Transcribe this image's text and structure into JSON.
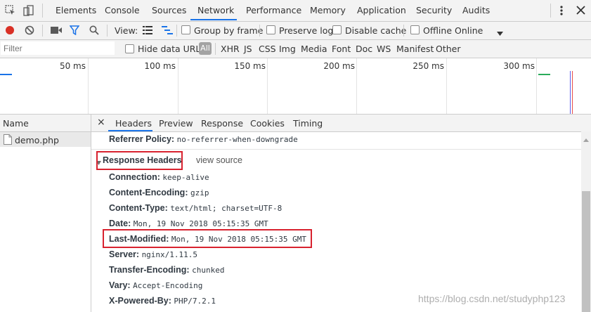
{
  "tabs": [
    "Elements",
    "Console",
    "Sources",
    "Network",
    "Performance",
    "Memory",
    "Application",
    "Security",
    "Audits"
  ],
  "toolbar": {
    "view_label": "View:",
    "group_by_frame": "Group by frame",
    "preserve_log": "Preserve log",
    "disable_cache": "Disable cache",
    "offline": "Offline",
    "throttle_value": "Online"
  },
  "filter": {
    "placeholder": "Filter",
    "hide_data_urls": "Hide data URLs",
    "all": "All",
    "types": [
      "XHR",
      "JS",
      "CSS",
      "Img",
      "Media",
      "Font",
      "Doc",
      "WS",
      "Manifest",
      "Other"
    ]
  },
  "timeline": {
    "ticks": [
      "50 ms",
      "100 ms",
      "150 ms",
      "200 ms",
      "250 ms",
      "300 ms"
    ]
  },
  "request_list": {
    "name_header": "Name",
    "rows": [
      {
        "name": "demo.php"
      }
    ]
  },
  "details": {
    "close": "×",
    "tabs": [
      "Headers",
      "Preview",
      "Response",
      "Cookies",
      "Timing"
    ],
    "referrer_policy": {
      "key": "Referrer Policy:",
      "value": "no-referrer-when-downgrade"
    },
    "response_headers_title": "Response Headers",
    "view_source": "view source",
    "headers": [
      {
        "key": "Connection:",
        "value": "keep-alive"
      },
      {
        "key": "Content-Encoding:",
        "value": "gzip"
      },
      {
        "key": "Content-Type:",
        "value": "text/html; charset=UTF-8"
      },
      {
        "key": "Date:",
        "value": "Mon, 19 Nov 2018 05:15:35 GMT"
      },
      {
        "key": "Last-Modified:",
        "value": "Mon, 19 Nov 2018 05:15:35 GMT"
      },
      {
        "key": "Server:",
        "value": "nginx/1.11.5"
      },
      {
        "key": "Transfer-Encoding:",
        "value": "chunked"
      },
      {
        "key": "Vary:",
        "value": "Accept-Encoding"
      },
      {
        "key": "X-Powered-By:",
        "value": "PHP/7.2.1"
      }
    ]
  },
  "watermark": "https://blog.csdn.net/studyphp123",
  "colors": {
    "accent": "#1a73e8",
    "record": "#d93025",
    "highlight_box": "#d8222f"
  }
}
